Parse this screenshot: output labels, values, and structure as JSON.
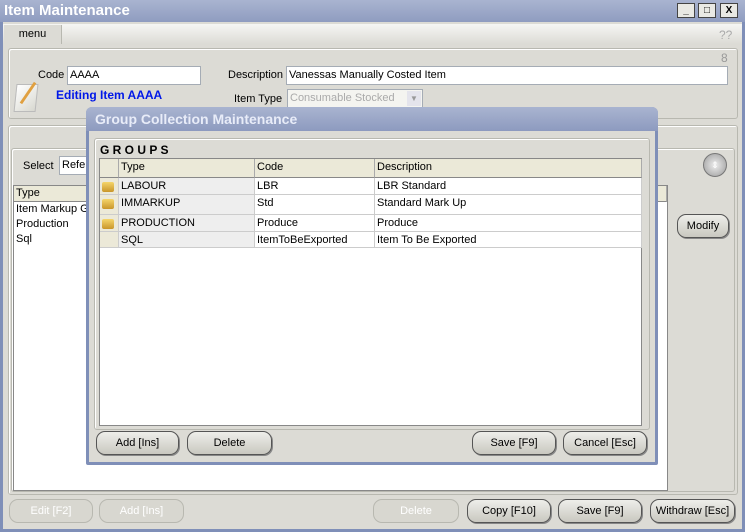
{
  "window": {
    "title": "Item Maintenance",
    "minimize": "_",
    "maximize": "□",
    "close": "X"
  },
  "menu": {
    "label": "menu",
    "help": "??"
  },
  "header": {
    "counter": "8",
    "code_label": "Code",
    "code_value": "AAAA",
    "status": "Editing Item AAAA",
    "description_label": "Description",
    "description_value": "Vanessas Manually Costed Item",
    "item_type_label": "Item Type",
    "item_type_value": "Consumable Stocked"
  },
  "lower": {
    "select_label": "Select",
    "select_value": "Refe",
    "columns": [
      "Type"
    ],
    "rows": [
      "Item Markup G",
      "Production",
      "Sql"
    ],
    "modify_label": "Modify"
  },
  "dialog": {
    "title": "Group Collection Maintenance",
    "section": "G R O U P S",
    "columns": [
      "Type",
      "Code",
      "Description"
    ],
    "rows": [
      {
        "key": true,
        "type": "LABOUR",
        "code": "LBR",
        "description": "LBR Standard"
      },
      {
        "key": true,
        "type": "IMMARKUP",
        "code": "Std",
        "description": "Standard Mark Up"
      },
      {
        "key": true,
        "type": "PRODUCTION",
        "code": "Produce",
        "description": "Produce"
      },
      {
        "key": false,
        "type": "SQL",
        "code": "ItemToBeExported",
        "description": "Item To Be Exported"
      }
    ],
    "add": "Add  [Ins]",
    "delete": "Delete",
    "save": "Save  [F9]",
    "cancel": "Cancel   [Esc]"
  },
  "footer": {
    "edit": "Edit    [F2]",
    "add": "Add    [Ins]",
    "delete": "Delete",
    "copy": "Copy  [F10]",
    "save": "Save   [F9]",
    "withdraw": "Withdraw [Esc]"
  }
}
